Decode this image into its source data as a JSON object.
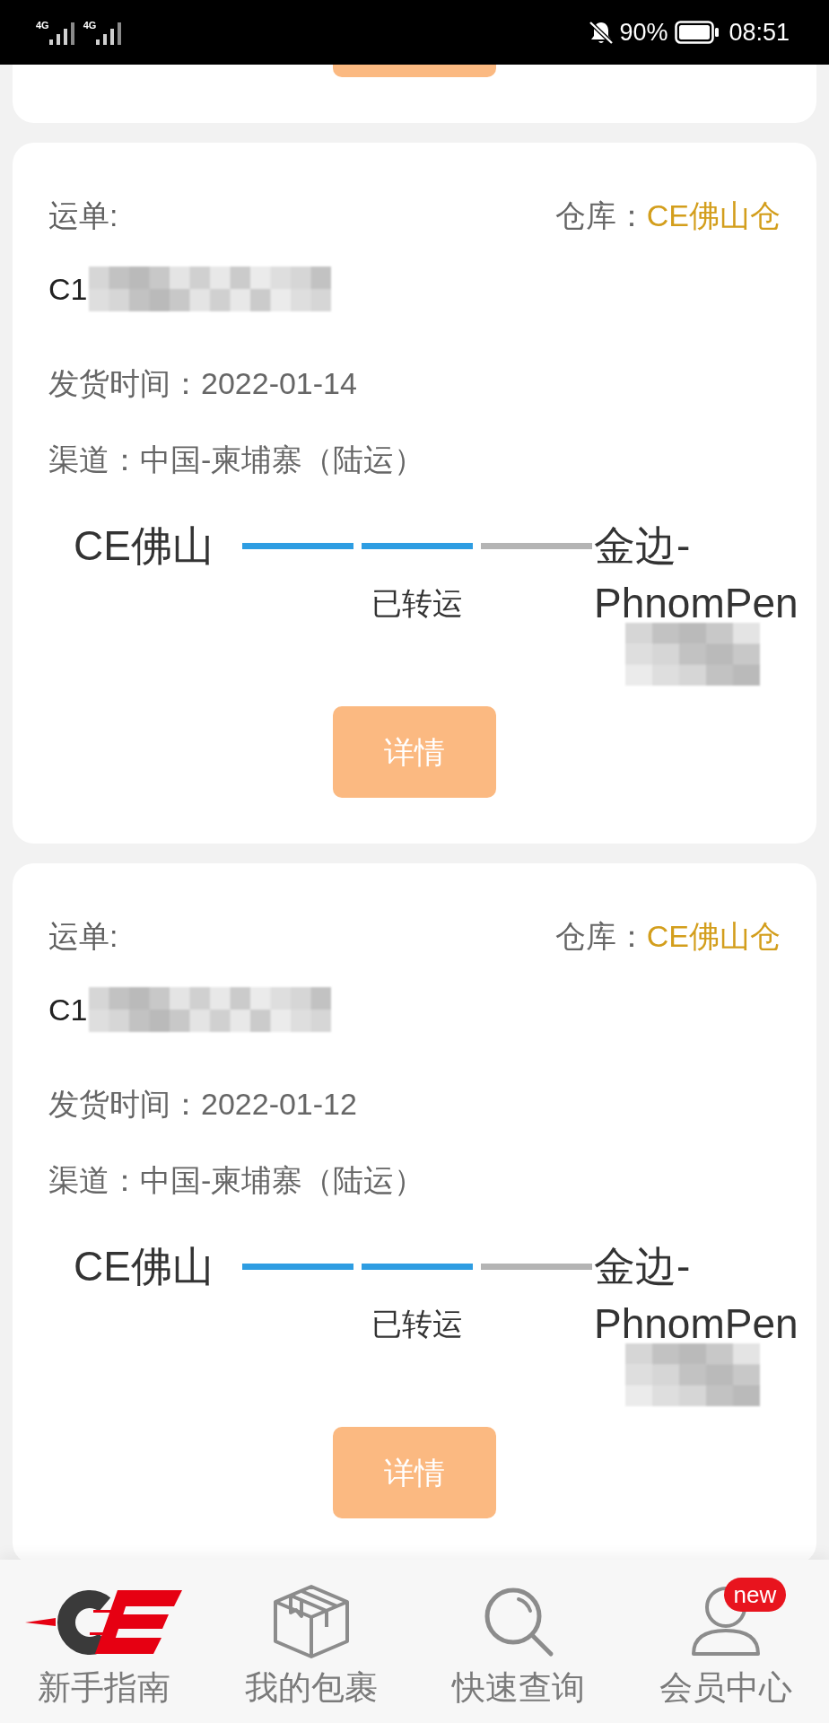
{
  "status_bar": {
    "networks": [
      "4G",
      "4G"
    ],
    "muted": true,
    "battery": "90%",
    "time": "08:51"
  },
  "shipments": [
    {
      "waybill_label": "运单:",
      "warehouse_label": "仓库：",
      "warehouse": "CE佛山仓",
      "tracking_number": "C1",
      "tracking_redacted": true,
      "ship_date": "发货时间：2022-01-14",
      "channel": "渠道：中国-柬埔寨（陆运）",
      "origin": "CE佛山",
      "segments": [
        {
          "done": true
        },
        {
          "done": true
        },
        {
          "done": false
        }
      ],
      "status": "已转运",
      "destination": "金边-PhnomPen",
      "destination_redacted": true,
      "button": "详情"
    },
    {
      "waybill_label": "运单:",
      "warehouse_label": "仓库：",
      "warehouse": "CE佛山仓",
      "tracking_number": "C1",
      "tracking_redacted": true,
      "ship_date": "发货时间：2022-01-12",
      "channel": "渠道：中国-柬埔寨（陆运）",
      "origin": "CE佛山",
      "segments": [
        {
          "done": true
        },
        {
          "done": true
        },
        {
          "done": false
        }
      ],
      "status": "已转运",
      "destination": "金边-PhnomPen",
      "destination_redacted": true,
      "button": "详情"
    }
  ],
  "tab_bar": {
    "items": [
      {
        "kind": "logo",
        "label": "新手指南"
      },
      {
        "kind": "package",
        "label": "我的包裹"
      },
      {
        "kind": "search",
        "label": "快速查询"
      },
      {
        "kind": "user",
        "label": "会员中心",
        "badge": "new"
      }
    ]
  }
}
